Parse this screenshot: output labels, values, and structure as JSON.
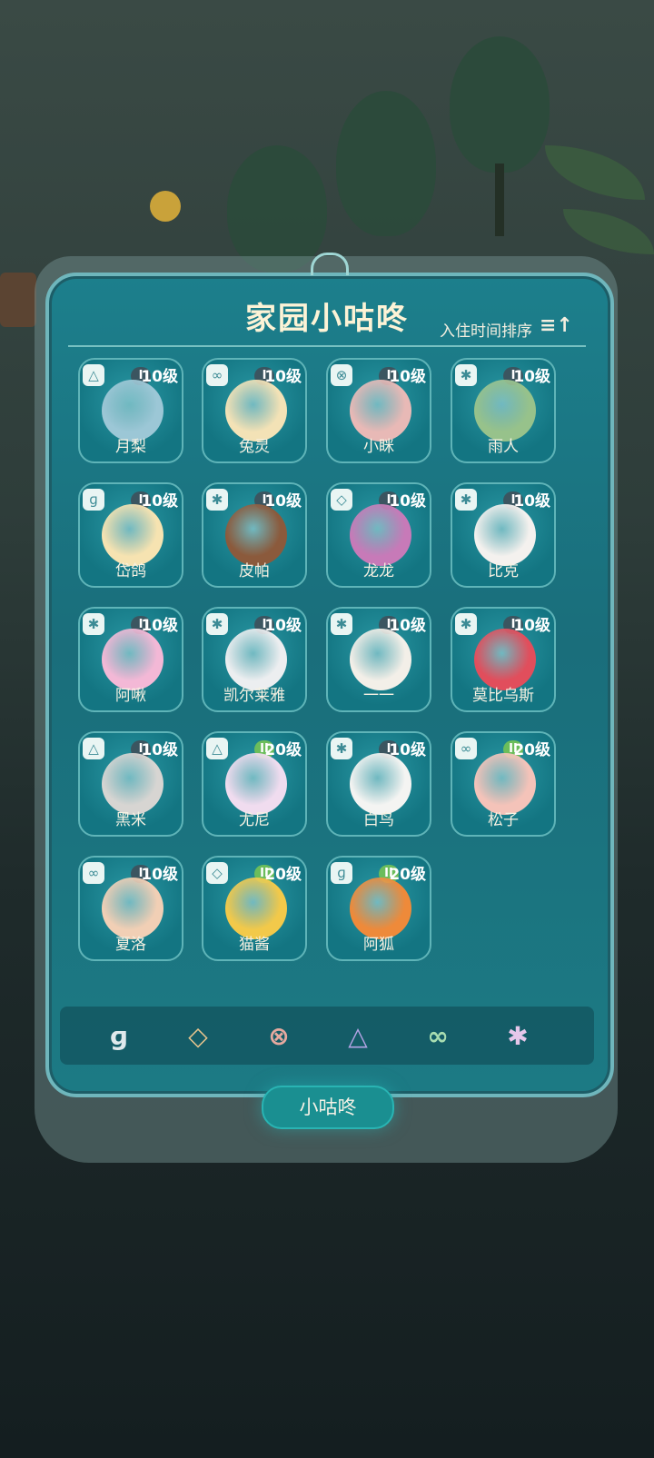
{
  "header": {
    "title": "家园小咕咚",
    "sort_label": "入住时间排序",
    "sort_icon": "≡↑"
  },
  "pets": [
    {
      "name": "月梨",
      "rank": "I",
      "level": "10级",
      "type_icon": "triangle-icon",
      "type_glyph": "△",
      "avatar_color": "#9cc7d6"
    },
    {
      "name": "兔灵",
      "rank": "I",
      "level": "10级",
      "type_icon": "infinity-icon",
      "type_glyph": "∞",
      "avatar_color": "#f3e2b6"
    },
    {
      "name": "小眯",
      "rank": "I",
      "level": "10级",
      "type_icon": "chain-icon",
      "type_glyph": "⊗",
      "avatar_color": "#e8b9b6"
    },
    {
      "name": "雨人",
      "rank": "I",
      "level": "10级",
      "type_icon": "rune-icon",
      "type_glyph": "✱",
      "avatar_color": "#97c28b"
    },
    {
      "name": "岱鸽",
      "rank": "I",
      "level": "10级",
      "type_icon": "clef-icon",
      "type_glyph": "ɡ",
      "avatar_color": "#f6e3b1"
    },
    {
      "name": "皮帕",
      "rank": "I",
      "level": "10级",
      "type_icon": "rune-icon",
      "type_glyph": "✱",
      "avatar_color": "#8b5a3c"
    },
    {
      "name": "龙龙",
      "rank": "I",
      "level": "10级",
      "type_icon": "eye-icon",
      "type_glyph": "◇",
      "avatar_color": "#c77ab8"
    },
    {
      "name": "比克",
      "rank": "I",
      "level": "10级",
      "type_icon": "rune-icon",
      "type_glyph": "✱",
      "avatar_color": "#f4f1ee"
    },
    {
      "name": "阿啾",
      "rank": "I",
      "level": "10级",
      "type_icon": "rune-icon",
      "type_glyph": "✱",
      "avatar_color": "#f3b8d6"
    },
    {
      "name": "凯尔莱雅",
      "rank": "I",
      "level": "10级",
      "type_icon": "rune-icon",
      "type_glyph": "✱",
      "avatar_color": "#eceef0"
    },
    {
      "name": "一一",
      "rank": "I",
      "level": "10级",
      "type_icon": "rune-icon",
      "type_glyph": "✱",
      "avatar_color": "#f3efe8"
    },
    {
      "name": "莫比乌斯",
      "rank": "I",
      "level": "10级",
      "type_icon": "rune-icon",
      "type_glyph": "✱",
      "avatar_color": "#e14e5c"
    },
    {
      "name": "黑米",
      "rank": "I",
      "level": "10级",
      "type_icon": "triangle-icon",
      "type_glyph": "△",
      "avatar_color": "#d7d5d2"
    },
    {
      "name": "尤尼",
      "rank": "II",
      "level": "20级",
      "type_icon": "triangle-icon",
      "type_glyph": "△",
      "avatar_color": "#f0dcef"
    },
    {
      "name": "白鸟",
      "rank": "I",
      "level": "10级",
      "type_icon": "rune-icon",
      "type_glyph": "✱",
      "avatar_color": "#f4f4f2"
    },
    {
      "name": "松子",
      "rank": "II",
      "level": "20级",
      "type_icon": "infinity-icon",
      "type_glyph": "∞",
      "avatar_color": "#f4c3b9"
    },
    {
      "name": "夏洛",
      "rank": "I",
      "level": "10级",
      "type_icon": "infinity-icon",
      "type_glyph": "∞",
      "avatar_color": "#f1cfb5"
    },
    {
      "name": "猫酱",
      "rank": "II",
      "level": "20级",
      "type_icon": "eye-icon",
      "type_glyph": "◇",
      "avatar_color": "#f2c94a"
    },
    {
      "name": "阿狐",
      "rank": "II",
      "level": "20级",
      "type_icon": "clef-icon",
      "type_glyph": "ɡ",
      "avatar_color": "#ee8a3a"
    }
  ],
  "tabs": [
    {
      "icon": "clef-icon",
      "glyph": "ɡ",
      "color": "#dfe9ec"
    },
    {
      "icon": "eye-icon",
      "glyph": "◇",
      "color": "#e9c58e"
    },
    {
      "icon": "chain-icon",
      "glyph": "⊗",
      "color": "#e6a99f"
    },
    {
      "icon": "triangle-icon",
      "glyph": "△",
      "color": "#b5a4e6"
    },
    {
      "icon": "infinity-icon",
      "glyph": "∞",
      "color": "#a8ddb1"
    },
    {
      "icon": "rune-icon",
      "glyph": "✱",
      "color": "#e6c7ea"
    }
  ],
  "footer": {
    "button_label": "小咕咚"
  }
}
